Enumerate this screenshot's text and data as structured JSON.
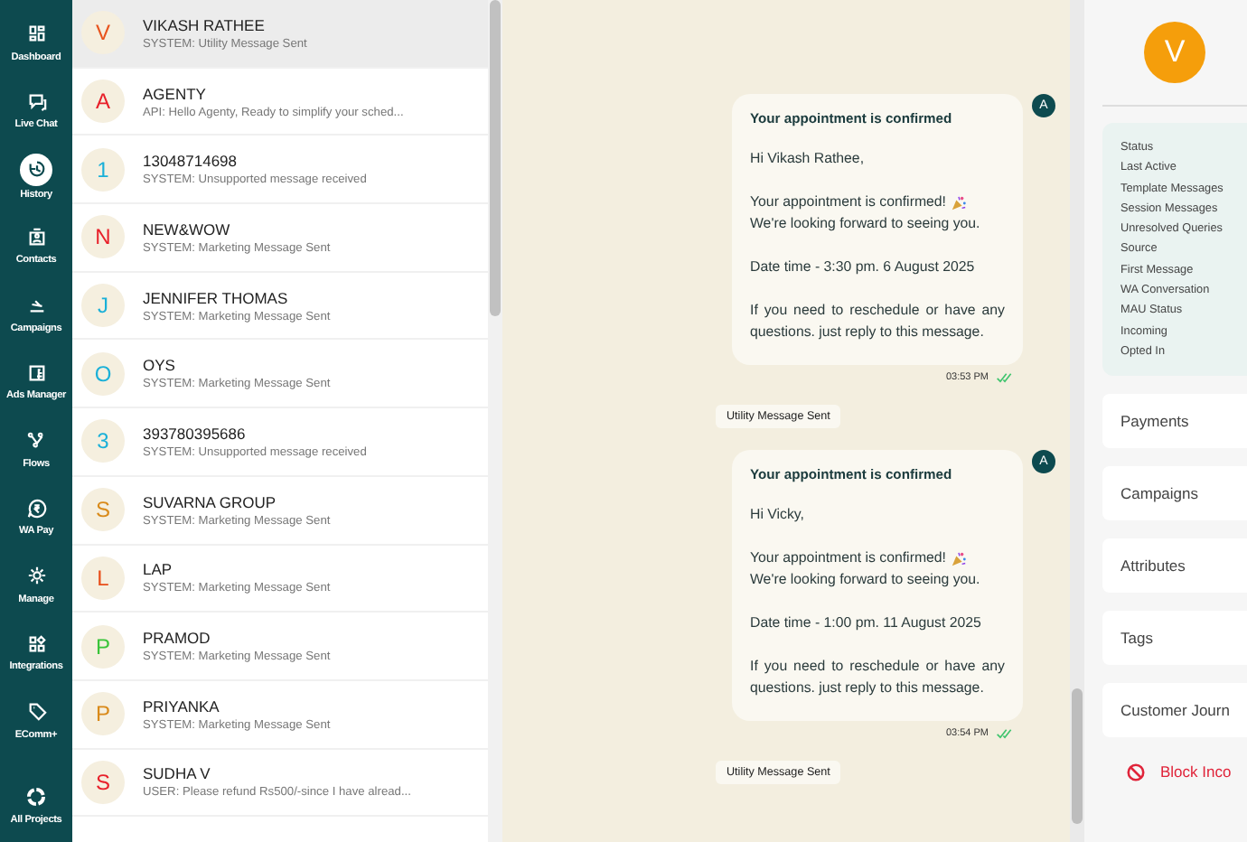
{
  "nav": {
    "items": [
      {
        "label": "Dashboard",
        "selected": false
      },
      {
        "label": "Live Chat",
        "selected": false
      },
      {
        "label": "History",
        "selected": true
      },
      {
        "label": "Contacts",
        "selected": false
      },
      {
        "label": "Campaigns",
        "selected": false
      },
      {
        "label": "Ads Manager",
        "selected": false
      },
      {
        "label": "Flows",
        "selected": false
      },
      {
        "label": "WA Pay",
        "selected": false
      },
      {
        "label": "Manage",
        "selected": false
      },
      {
        "label": "Integrations",
        "selected": false
      },
      {
        "label": "EComm+",
        "selected": false
      }
    ],
    "footer": {
      "label": "All Projects"
    }
  },
  "contacts": [
    {
      "initial": "V",
      "name": "VIKASH RATHEE",
      "preview": "SYSTEM: Utility Message Sent",
      "color": "#e8541e",
      "selected": true
    },
    {
      "initial": "A",
      "name": "AGENTY",
      "preview": "API: Hello Agenty, Ready to simplify your sched...",
      "color": "#e8202a",
      "selected": false
    },
    {
      "initial": "1",
      "name": "13048714698",
      "preview": "SYSTEM: Unsupported message received",
      "color": "#1ab0d8",
      "selected": false
    },
    {
      "initial": "N",
      "name": "NEW&WOW",
      "preview": "SYSTEM: Marketing Message Sent",
      "color": "#e8202a",
      "selected": false
    },
    {
      "initial": "J",
      "name": "JENNIFER THOMAS",
      "preview": "SYSTEM: Marketing Message Sent",
      "color": "#1ab0d8",
      "selected": false
    },
    {
      "initial": "O",
      "name": "OYS",
      "preview": "SYSTEM: Marketing Message Sent",
      "color": "#1ab0d8",
      "selected": false
    },
    {
      "initial": "3",
      "name": "393780395686",
      "preview": "SYSTEM: Unsupported message received",
      "color": "#1ab0d8",
      "selected": false
    },
    {
      "initial": "S",
      "name": "SUVARNA GROUP",
      "preview": "SYSTEM: Marketing Message Sent",
      "color": "#d98a1a",
      "selected": false
    },
    {
      "initial": "L",
      "name": "LAP",
      "preview": "SYSTEM: Marketing Message Sent",
      "color": "#e84e1a",
      "selected": false
    },
    {
      "initial": "P",
      "name": "PRAMOD",
      "preview": "SYSTEM: Marketing Message Sent",
      "color": "#3ac43a",
      "selected": false
    },
    {
      "initial": "P",
      "name": "PRIYANKA",
      "preview": "SYSTEM: Marketing Message Sent",
      "color": "#d98a1a",
      "selected": false
    },
    {
      "initial": "S",
      "name": "SUDHA V",
      "preview": "USER: Please refund Rs500/-since I have alread...",
      "color": "#e8202a",
      "selected": false
    }
  ],
  "chat": [
    {
      "kind": "bubble",
      "avatar": "A",
      "title": "Your appointment is confirmed",
      "paragraphs": [
        {
          "text": "Hi Vikash Rathee,"
        },
        {
          "text": "Your appointment is confirmed!",
          "party_icon": true,
          "rest": "We're looking forward to seeing you."
        },
        {
          "text": "Date time - 3:30 pm. 6 August 2025"
        },
        {
          "text": "If you need to reschedule or have any questions. just reply to this message."
        }
      ],
      "time": "03:53 PM",
      "read": true
    },
    {
      "kind": "event",
      "label": "Utility Message Sent"
    },
    {
      "kind": "bubble",
      "avatar": "A",
      "title": "Your appointment is confirmed",
      "paragraphs": [
        {
          "text": "Hi Vicky,"
        },
        {
          "text": "Your appointment is confirmed!",
          "party_icon": true,
          "rest": "We're looking forward to seeing you."
        },
        {
          "text": "Date time - 1:00 pm. 11 August 2025"
        },
        {
          "text": "If you need to reschedule or have any questions. just reply to this message."
        }
      ],
      "time": "03:54 PM",
      "read": true
    },
    {
      "kind": "event",
      "label": "Utility Message Sent"
    }
  ],
  "profile": {
    "initial": "V",
    "details": [
      "Status",
      "Last Active",
      "Template Messages",
      "Session Messages",
      "Unresolved Queries",
      "Source",
      "First Message",
      "WA Conversation",
      "MAU Status",
      "Incoming",
      "Opted In"
    ],
    "sections": [
      "Payments",
      "Campaigns",
      "Attributes",
      "Tags",
      "Customer Journ"
    ],
    "block_action": "Block Inco"
  }
}
